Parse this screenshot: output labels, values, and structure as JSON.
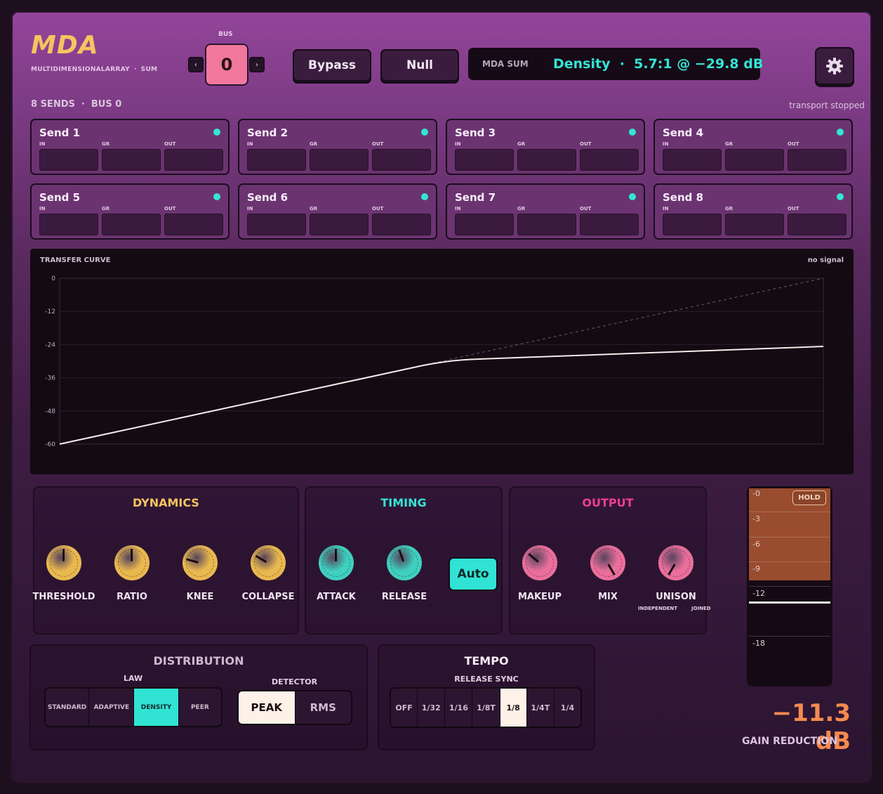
{
  "header": {
    "logo": "MDA",
    "subtitle_left": "MULTIDIMENSIONALARRAY",
    "subtitle_dot": "·",
    "subtitle_right": "SUM",
    "bus_label": "BUS",
    "bus_value": "0",
    "bus_prev": "‹",
    "bus_next": "›",
    "bypass_label": "Bypass",
    "null_label": "Null",
    "display_tag": "MDA SUM",
    "display_readout": "Density  ·  5.7:1 @ −29.8 dB"
  },
  "sends_header": {
    "count_text": "8 SENDS  ·  BUS 0",
    "transport": "transport stopped"
  },
  "sends": [
    {
      "name": "Send 1",
      "in": "IN",
      "gr": "GR",
      "out": "OUT"
    },
    {
      "name": "Send 2",
      "in": "IN",
      "gr": "GR",
      "out": "OUT"
    },
    {
      "name": "Send 3",
      "in": "IN",
      "gr": "GR",
      "out": "OUT"
    },
    {
      "name": "Send 4",
      "in": "IN",
      "gr": "GR",
      "out": "OUT"
    },
    {
      "name": "Send 5",
      "in": "IN",
      "gr": "GR",
      "out": "OUT"
    },
    {
      "name": "Send 6",
      "in": "IN",
      "gr": "GR",
      "out": "OUT"
    },
    {
      "name": "Send 7",
      "in": "IN",
      "gr": "GR",
      "out": "OUT"
    },
    {
      "name": "Send 8",
      "in": "IN",
      "gr": "GR",
      "out": "OUT"
    }
  ],
  "transfer_curve": {
    "title": "TRANSFER CURVE",
    "status": "no signal",
    "y_ticks": [
      "0",
      "-12",
      "-24",
      "-36",
      "-48",
      "-60"
    ]
  },
  "dynamics": {
    "title": "DYNAMICS",
    "knobs": [
      {
        "label": "THRESHOLD",
        "angle": 0
      },
      {
        "label": "RATIO",
        "angle": 0
      },
      {
        "label": "KNEE",
        "angle": -75
      },
      {
        "label": "COLLAPSE",
        "angle": -60
      }
    ]
  },
  "timing": {
    "title": "TIMING",
    "knobs": [
      {
        "label": "ATTACK",
        "angle": 0
      },
      {
        "label": "RELEASE",
        "angle": -20
      }
    ],
    "auto_label": "Auto"
  },
  "output": {
    "title": "OUTPUT",
    "knobs": [
      {
        "label": "MAKEUP",
        "angle": -50
      },
      {
        "label": "MIX",
        "angle": 150
      },
      {
        "label": "UNISON",
        "angle": -150
      }
    ],
    "unison_left": "INDEPENDENT",
    "unison_right": "JOINED"
  },
  "distribution": {
    "title": "DISTRIBUTION",
    "law_label": "LAW",
    "law_options": [
      "STANDARD",
      "ADAPTIVE",
      "DENSITY",
      "PEER"
    ],
    "law_selected": "DENSITY",
    "detector_label": "DETECTOR",
    "detector_options": [
      "PEAK",
      "RMS"
    ],
    "detector_selected": "PEAK"
  },
  "tempo": {
    "title": "TEMPO",
    "release_sync_label": "RELEASE SYNC",
    "options": [
      "OFF",
      "1/32",
      "1/16",
      "1/8T",
      "1/8",
      "1/4T",
      "1/4"
    ],
    "selected": "1/8"
  },
  "meter": {
    "hold_label": "HOLD",
    "scale": [
      "-0",
      "-3",
      "-6",
      "-9",
      "-12",
      "-18"
    ],
    "gain_reduction_value": "−11.3 dB",
    "gain_reduction_label": "GAIN REDUCTION"
  },
  "colors": {
    "accent_teal": "#31e3d4",
    "accent_pink": "#f1789c",
    "accent_yellow": "#f6c35f",
    "accent_orange": "#f58a4f"
  }
}
